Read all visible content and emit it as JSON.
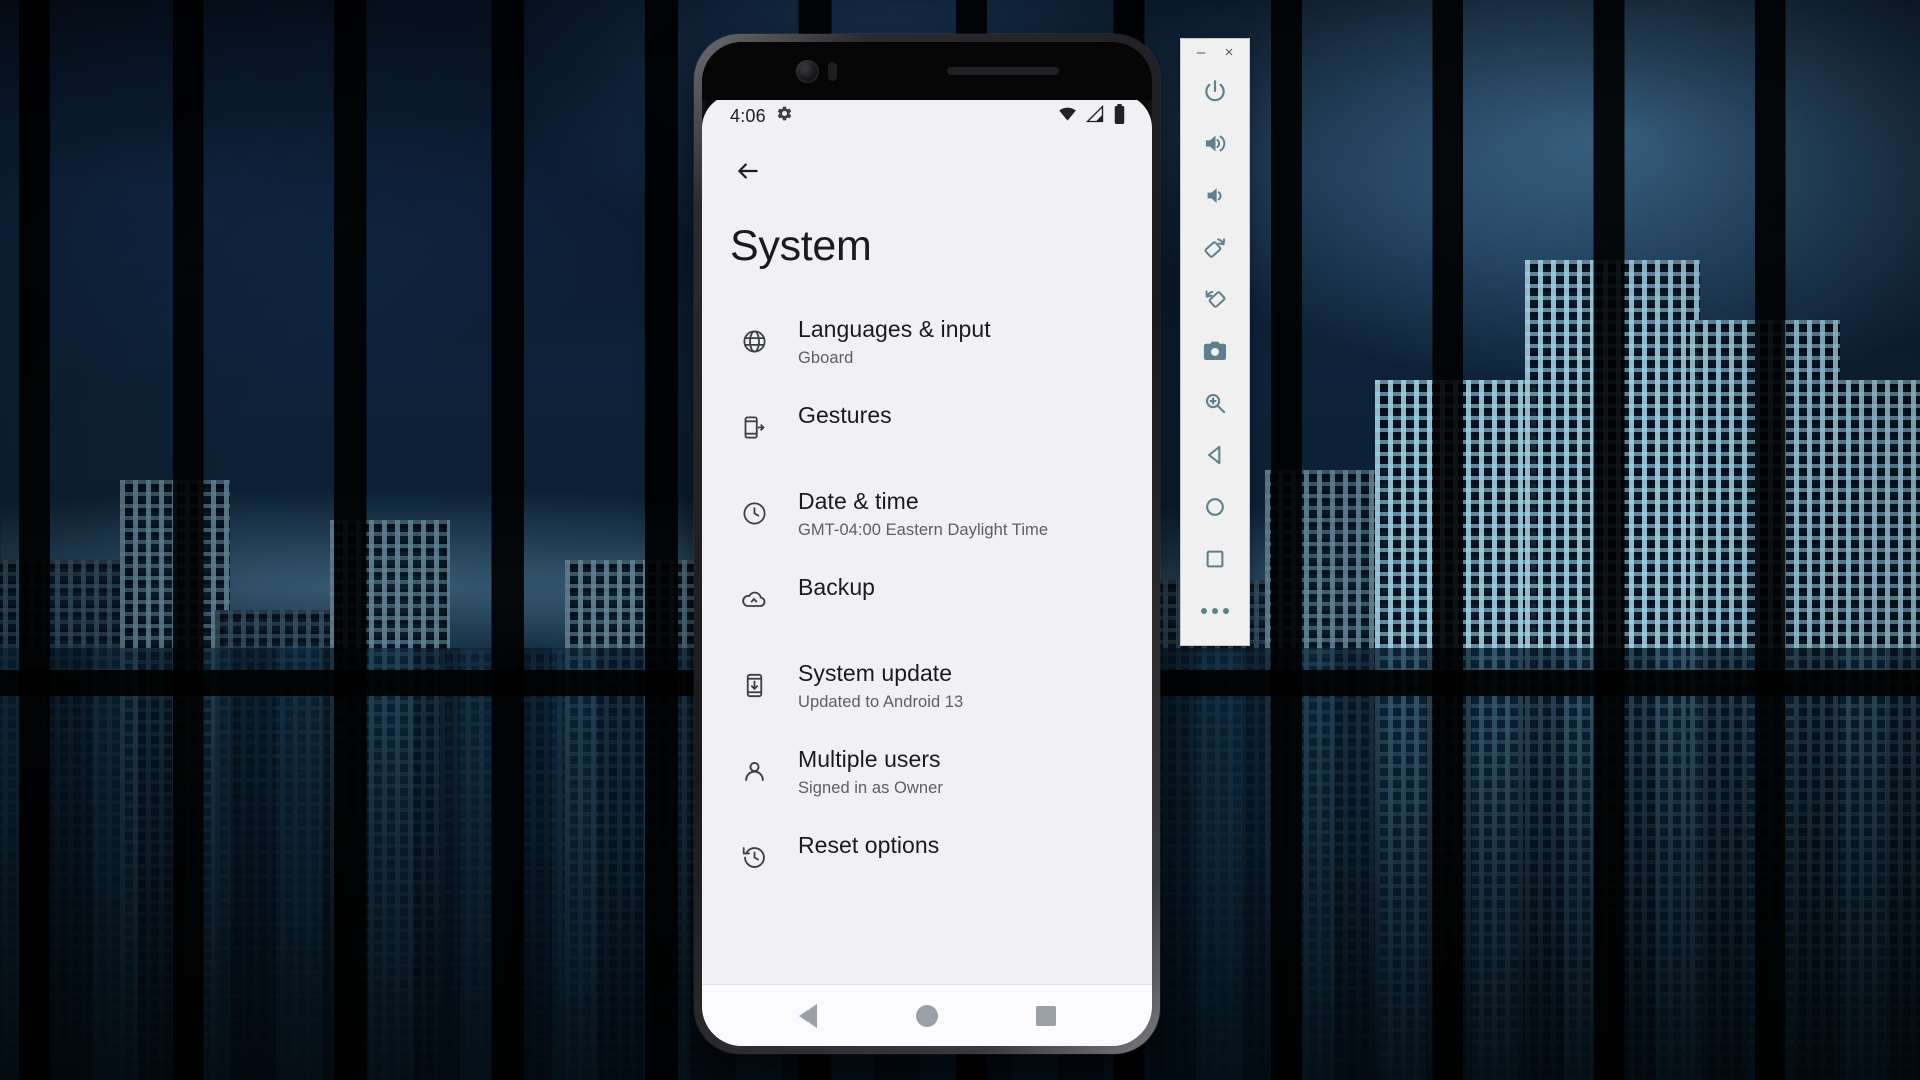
{
  "wallpaper": {
    "description": "night-cityscape-through-windows"
  },
  "emulator_toolbar": {
    "window_controls": [
      {
        "name": "minimize-button",
        "glyph": "–"
      },
      {
        "name": "close-button",
        "glyph": "×"
      }
    ],
    "buttons": [
      {
        "name": "power-button",
        "icon": "power-icon",
        "tooltip": "Power"
      },
      {
        "name": "volume-up-button",
        "icon": "volume-up-icon",
        "tooltip": "Volume Up"
      },
      {
        "name": "volume-down-button",
        "icon": "volume-down-icon",
        "tooltip": "Volume Down"
      },
      {
        "name": "rotate-left-button",
        "icon": "rotate-left-icon",
        "tooltip": "Rotate Left"
      },
      {
        "name": "rotate-right-button",
        "icon": "rotate-right-icon",
        "tooltip": "Rotate Right"
      },
      {
        "name": "screenshot-button",
        "icon": "camera-icon",
        "tooltip": "Take Screenshot"
      },
      {
        "name": "zoom-button",
        "icon": "zoom-in-icon",
        "tooltip": "Enter zoom mode"
      },
      {
        "name": "back-button",
        "icon": "back-triangle-icon",
        "tooltip": "Back"
      },
      {
        "name": "home-button",
        "icon": "home-circle-icon",
        "tooltip": "Home"
      },
      {
        "name": "overview-button",
        "icon": "overview-square-icon",
        "tooltip": "Overview"
      },
      {
        "name": "more-button",
        "icon": "more-dots-icon",
        "tooltip": "More"
      }
    ],
    "accent_color": "#5d7f8e",
    "panel_color": "#f0f0f0"
  },
  "phone": {
    "status_bar": {
      "time": "4:06",
      "left_icons": [
        "settings-gear-icon"
      ],
      "right_icons": [
        "wifi-icon",
        "cellular-signal-icon",
        "battery-icon"
      ]
    },
    "app_bar": {
      "back_icon": "back-arrow-icon"
    },
    "page_title": "System",
    "settings": [
      {
        "icon": "globe-icon",
        "title": "Languages & input",
        "subtitle": "Gboard"
      },
      {
        "icon": "gestures-icon",
        "title": "Gestures",
        "subtitle": ""
      },
      {
        "icon": "clock-icon",
        "title": "Date & time",
        "subtitle": "GMT-04:00 Eastern Daylight Time"
      },
      {
        "icon": "cloud-upload-icon",
        "title": "Backup",
        "subtitle": ""
      },
      {
        "icon": "system-update-icon",
        "title": "System update",
        "subtitle": "Updated to Android 13"
      },
      {
        "icon": "person-icon",
        "title": "Multiple users",
        "subtitle": "Signed in as Owner"
      },
      {
        "icon": "reset-history-icon",
        "title": "Reset options",
        "subtitle": ""
      }
    ],
    "nav_bar": [
      {
        "name": "nav-back-button",
        "icon": "back-triangle-icon"
      },
      {
        "name": "nav-home-button",
        "icon": "home-circle-icon"
      },
      {
        "name": "nav-recents-button",
        "icon": "recents-square-icon"
      }
    ],
    "colors": {
      "screen_bg": "#f1f0f4",
      "title_text": "#1b1b1f",
      "subtitle_text": "#5c5f63"
    }
  }
}
